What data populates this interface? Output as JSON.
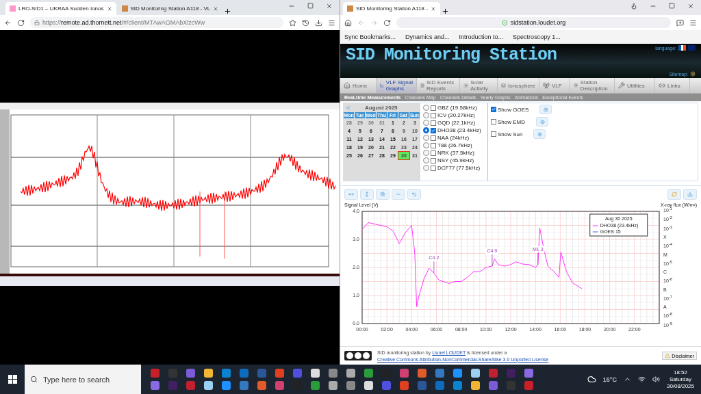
{
  "left_browser": {
    "tabs": [
      {
        "title": "LRO-SID1 – UKRAA Sudden Ionos",
        "selected": true
      },
      {
        "title": "SID Monitoring Station A118 - VL",
        "selected": false
      }
    ],
    "url_scheme": "https://",
    "url_host": "remote.ad.thornett.net",
    "url_path": "/#/client/MTAwAGMAbXlzcWw"
  },
  "right_browser": {
    "tabs": [
      {
        "title": "SID Monitoring Station A118 -",
        "selected": true
      }
    ],
    "url": "sidstation.loudet.org",
    "bookmarks": [
      "Sync Bookmarks...",
      "Dynamics and...",
      "Introduction to...",
      "Spectroscopy 1..."
    ]
  },
  "site": {
    "title": "SID Monitoring Station",
    "language_label": "language:",
    "sitemap_label": "Sitemap:",
    "nav": [
      {
        "label": "Home",
        "selected": false
      },
      {
        "label": "VLF Signal Graphs",
        "selected": true
      },
      {
        "label": "SID Events Reports",
        "selected": false
      },
      {
        "label": "Solar Activity",
        "selected": false
      },
      {
        "label": "Ionosphere",
        "selected": false
      },
      {
        "label": "VLF",
        "selected": false
      },
      {
        "label": "Station Description",
        "selected": false
      },
      {
        "label": "Utilities",
        "selected": false
      },
      {
        "label": "Links",
        "selected": false
      }
    ],
    "subnav": [
      {
        "label": "Real-time Measurements",
        "selected": true
      },
      {
        "label": "Channels Map",
        "selected": false
      },
      {
        "label": "Channels Details",
        "selected": false
      },
      {
        "label": "Yearly Graphs",
        "selected": false
      },
      {
        "label": "Animations",
        "selected": false
      },
      {
        "label": "Exceptional Events",
        "selected": false
      }
    ],
    "calendar": {
      "month": "August 2025",
      "weekdays": [
        "Mon",
        "Tue",
        "Wed",
        "Thu",
        "Fri",
        "Sat",
        "Sun"
      ],
      "weeks": [
        [
          {
            "day": "28",
            "other_month": true,
            "selected": false
          },
          {
            "day": "29",
            "other_month": true,
            "selected": false
          },
          {
            "day": "30",
            "other_month": true,
            "selected": false
          },
          {
            "day": "31",
            "other_month": true,
            "selected": false
          },
          {
            "day": "1",
            "other_month": false,
            "selected": false
          },
          {
            "day": "2",
            "other_month": false,
            "selected": false
          },
          {
            "day": "3",
            "other_month": false,
            "selected": false
          }
        ],
        [
          {
            "day": "4",
            "other_month": false,
            "selected": false
          },
          {
            "day": "5",
            "other_month": false,
            "selected": false
          },
          {
            "day": "6",
            "other_month": false,
            "selected": false
          },
          {
            "day": "7",
            "other_month": false,
            "selected": false
          },
          {
            "day": "8",
            "other_month": false,
            "selected": false
          },
          {
            "day": "9",
            "other_month": false,
            "selected": false
          },
          {
            "day": "10",
            "other_month": false,
            "selected": false
          }
        ],
        [
          {
            "day": "11",
            "other_month": false,
            "selected": false
          },
          {
            "day": "12",
            "other_month": false,
            "selected": false
          },
          {
            "day": "13",
            "other_month": false,
            "selected": false
          },
          {
            "day": "14",
            "other_month": false,
            "selected": false
          },
          {
            "day": "15",
            "other_month": false,
            "selected": false
          },
          {
            "day": "16",
            "other_month": false,
            "selected": false
          },
          {
            "day": "17",
            "other_month": false,
            "selected": false
          }
        ],
        [
          {
            "day": "18",
            "other_month": false,
            "selected": false
          },
          {
            "day": "19",
            "other_month": false,
            "selected": false
          },
          {
            "day": "20",
            "other_month": false,
            "selected": false
          },
          {
            "day": "21",
            "other_month": false,
            "selected": false
          },
          {
            "day": "22",
            "other_month": false,
            "selected": false
          },
          {
            "day": "23",
            "other_month": false,
            "selected": false
          },
          {
            "day": "24",
            "other_month": false,
            "selected": false
          }
        ],
        [
          {
            "day": "25",
            "other_month": false,
            "selected": false
          },
          {
            "day": "26",
            "other_month": false,
            "selected": false
          },
          {
            "day": "27",
            "other_month": false,
            "selected": false
          },
          {
            "day": "28",
            "other_month": false,
            "selected": false
          },
          {
            "day": "29",
            "other_month": false,
            "selected": false
          },
          {
            "day": "30",
            "other_month": false,
            "selected": true
          },
          {
            "day": "31",
            "other_month": false,
            "selected": false
          }
        ]
      ]
    },
    "stations": [
      {
        "label": "GBZ (19.58kHz)",
        "selected": false,
        "checked": false
      },
      {
        "label": "ICV (20.27kHz)",
        "selected": false,
        "checked": false
      },
      {
        "label": "GQD (22.1kHz)",
        "selected": false,
        "checked": false
      },
      {
        "label": "DHO38 (23.4kHz)",
        "selected": true,
        "checked": true
      },
      {
        "label": "NAA (24kHz)",
        "selected": false,
        "checked": false
      },
      {
        "label": "T88 (26.7kHz)",
        "selected": false,
        "checked": false
      },
      {
        "label": "NRK (37.5kHz)",
        "selected": false,
        "checked": false
      },
      {
        "label": "NSY (45.9kHz)",
        "selected": false,
        "checked": false
      },
      {
        "label": "DCF77 (77.5kHz)",
        "selected": false,
        "checked": false
      }
    ],
    "overlays": [
      {
        "label": "Show GOES",
        "checked": true
      },
      {
        "label": "Show EMD",
        "checked": false
      },
      {
        "label": "Show Sun",
        "checked": false
      }
    ],
    "graph": {
      "right_axis_title": "X-ray flux (W/m²)",
      "right_ticks": [
        "10$^{-1}$",
        "10$^{-2}$",
        "10$^{-3}$",
        "X",
        "10$^{-4}$",
        "M",
        "10$^{-5}$",
        "C",
        "10$^{-6}$",
        "B",
        "10$^{-7}$",
        "A",
        "10$^{-8}$",
        "10$^{-9}$"
      ],
      "legend": {
        "date": "Aug 30 2025",
        "items": [
          "GOES 15"
        ]
      },
      "chart_data": {
        "type": "line",
        "ylabel": "Signal Level (V)",
        "xlim": [
          0,
          24
        ],
        "ylim": [
          0,
          4
        ],
        "grid": true,
        "xticks": [
          {
            "value": 0,
            "label": "00:00"
          },
          {
            "value": 2,
            "label": "02:00"
          },
          {
            "value": 4,
            "label": "04:00"
          },
          {
            "value": 6,
            "label": "06:00"
          },
          {
            "value": 8,
            "label": "08:00"
          },
          {
            "value": 10,
            "label": "10:00"
          },
          {
            "value": 12,
            "label": "12:00"
          },
          {
            "value": 14,
            "label": "14:00"
          },
          {
            "value": 16,
            "label": "16:00"
          },
          {
            "value": 18,
            "label": "18:00"
          },
          {
            "value": 20,
            "label": "20:00"
          },
          {
            "value": 22,
            "label": "22:00"
          }
        ],
        "yticks": [
          {
            "value": 0,
            "label": "0.0"
          },
          {
            "value": 1,
            "label": "1.0"
          },
          {
            "value": 2,
            "label": "2.0"
          },
          {
            "value": 3,
            "label": "3.0"
          },
          {
            "value": 4,
            "label": "4.0"
          }
        ],
        "x": [
          0,
          0.5,
          1,
          1.5,
          2,
          2.5,
          3,
          3.5,
          4,
          4.25,
          4.4,
          4.6,
          5,
          5.4,
          5.8,
          6.2,
          7,
          7.5,
          8,
          8.5,
          9,
          9.5,
          10,
          10.5,
          10.7,
          11,
          11.5,
          12,
          12.4,
          13,
          13.5,
          14,
          14.2,
          14.35,
          14.7,
          15,
          15.5,
          15.9,
          16.05,
          16.5,
          17,
          17.75
        ],
        "series": [
          {
            "name": "DHO38 (23.4kHz)",
            "color": "#ff33ff",
            "values": [
              3.35,
              3.6,
              3.55,
              3.5,
              3.45,
              3.3,
              2.85,
              3.25,
              3.5,
              2.5,
              0.6,
              1.0,
              1.6,
              1.97,
              1.8,
              1.55,
              1.43,
              1.5,
              1.5,
              1.65,
              1.85,
              1.85,
              2.0,
              2.05,
              2.3,
              2.1,
              2.05,
              2.1,
              2.2,
              2.12,
              2.1,
              2.0,
              2.1,
              3.4,
              2.6,
              2.05,
              1.85,
              1.65,
              2.55,
              1.85,
              1.45,
              1.25
            ]
          }
        ],
        "annotations": [
          {
            "x": 5.8,
            "y": 1.8,
            "text": "C4.2"
          },
          {
            "x": 10.5,
            "y": 2.05,
            "text": "C4.9"
          },
          {
            "x": 14.2,
            "y": 2.1,
            "text": "M1.3"
          }
        ]
      }
    },
    "footer": {
      "credit_before": "SID monitoring station by",
      "credit_link": "Lionel LOUDET",
      "credit_after": "is licensed under a",
      "license_link": "Creative Commons Attribution-NonCommercial-ShareAlike 3.0 Unported License",
      "disclaimer": "Disclaimer"
    }
  },
  "taskbar": {
    "search_placeholder": "Type here to search",
    "temperature": "16°C",
    "time": "18:52",
    "day": "Saturday",
    "date": "30/08/2025"
  }
}
